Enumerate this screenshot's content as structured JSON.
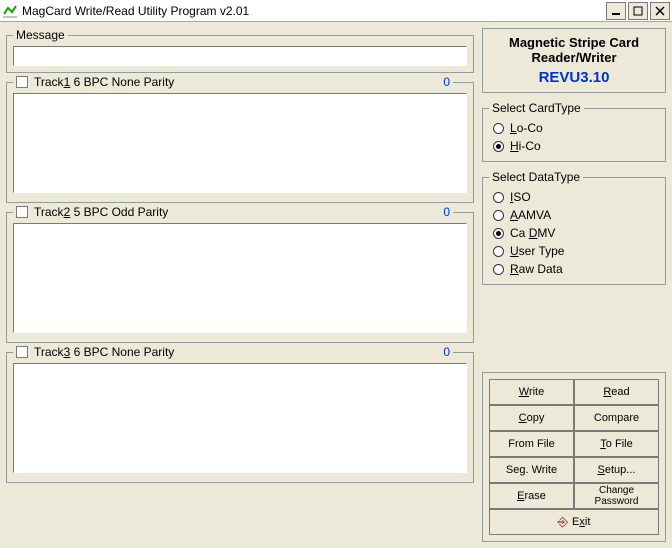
{
  "window": {
    "title": "MagCard Write/Read Utility Program v2.01"
  },
  "message": {
    "legend": "Message",
    "value": ""
  },
  "tracks": [
    {
      "checked": false,
      "label_pre": "Track",
      "label_uchar": "1",
      "label_post": "   6 BPC  None Parity",
      "count": "0",
      "value": ""
    },
    {
      "checked": false,
      "label_pre": "Track",
      "label_uchar": "2",
      "label_post": "   5 BPC  Odd Parity",
      "count": "0",
      "value": ""
    },
    {
      "checked": false,
      "label_pre": "Track",
      "label_uchar": "3",
      "label_post": "   6 BPC  None Parity",
      "count": "0",
      "value": ""
    }
  ],
  "info": {
    "line1": "Magnetic Stripe Card",
    "line2": "Reader/Writer",
    "rev": "REVU3.10"
  },
  "cardtype": {
    "legend": "Select CardType",
    "options": [
      {
        "pre": "",
        "u": "L",
        "post": "o-Co",
        "sel": false
      },
      {
        "pre": "",
        "u": "H",
        "post": "i-Co",
        "sel": true
      }
    ]
  },
  "datatype": {
    "legend": "Select DataType",
    "options": [
      {
        "pre": "",
        "u": "I",
        "post": "SO",
        "sel": false
      },
      {
        "pre": "",
        "u": "A",
        "post": "AMVA",
        "sel": false
      },
      {
        "pre": "Ca ",
        "u": "D",
        "post": "MV",
        "sel": true
      },
      {
        "pre": "",
        "u": "U",
        "post": "ser Type",
        "sel": false
      },
      {
        "pre": "",
        "u": "R",
        "post": "aw Data",
        "sel": false
      }
    ]
  },
  "buttons": {
    "write": {
      "u": "W",
      "rest": "rite"
    },
    "read": {
      "u": "R",
      "rest": "ead"
    },
    "copy": {
      "u": "C",
      "rest": "opy"
    },
    "compare": {
      "u": "",
      "rest": "Compare"
    },
    "fromfile": {
      "u": "",
      "rest": "From File"
    },
    "tofile": {
      "u": "T",
      "pre": "",
      "rest": "o File"
    },
    "segwrite": {
      "u": "",
      "rest": "Seg. Write"
    },
    "setup": {
      "u": "S",
      "rest": "etup..."
    },
    "erase": {
      "u": "E",
      "rest": "rase"
    },
    "chpwd_l1": "Change",
    "chpwd_l2": "Password",
    "exit": {
      "u": "x",
      "pre": "E",
      "rest": "it"
    }
  }
}
